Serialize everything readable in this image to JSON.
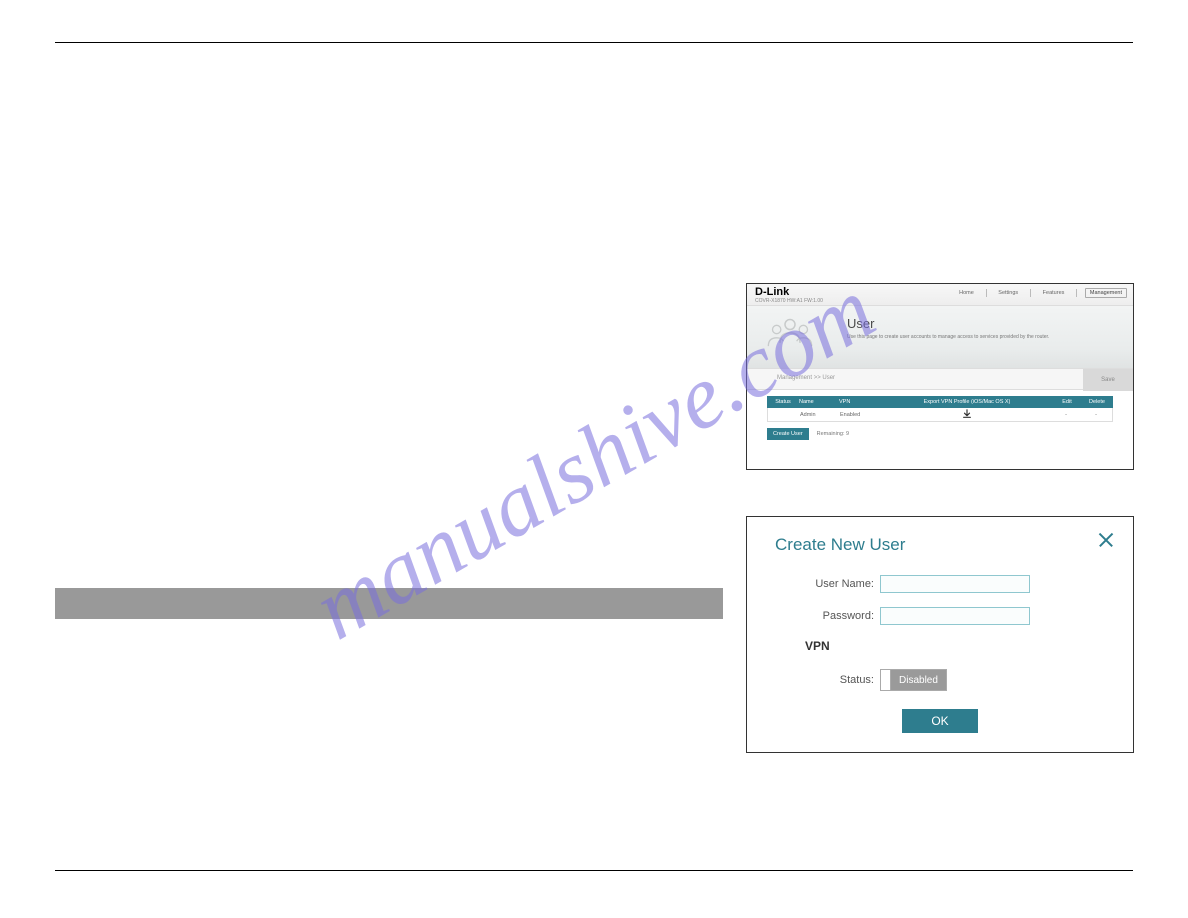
{
  "watermark": "manualshive.com",
  "user_page": {
    "brand": "D-Link",
    "model": "COVR-X1870  HW:A1  FW:1.00",
    "nav": {
      "home": "Home",
      "settings": "Settings",
      "features": "Features",
      "management": "Management"
    },
    "hero": {
      "title": "User",
      "description": "Use this page to create user accounts to manage access to services provided by the router."
    },
    "breadcrumb": "Management >> User",
    "save_label": "Save",
    "table": {
      "headers": {
        "status": "Status",
        "name": "Name",
        "vpn": "VPN",
        "export": "Export VPN Profile (iOS/Mac OS X)",
        "edit": "Edit",
        "delete": "Delete"
      },
      "row": {
        "status": "",
        "name": "Admin",
        "vpn": "Enabled",
        "edit": "-",
        "delete": "-"
      }
    },
    "create_user_label": "Create User",
    "remaining": "Remaining: 9"
  },
  "dialog": {
    "title": "Create New User",
    "username_label": "User Name:",
    "password_label": "Password:",
    "vpn_heading": "VPN",
    "status_label": "Status:",
    "status_value": "Disabled",
    "ok_label": "OK"
  }
}
